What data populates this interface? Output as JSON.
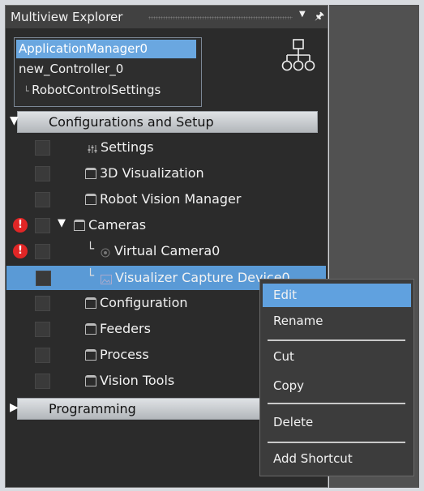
{
  "panel": {
    "title": "Multiview Explorer"
  },
  "controllers": [
    "ApplicationManager0",
    "new_Controller_0",
    "RobotControlSettings"
  ],
  "sections": {
    "config": "Configurations and Setup",
    "programming": "Programming"
  },
  "tree": {
    "settings": "Settings",
    "visualization": "3D Visualization",
    "robot_vision": "Robot Vision Manager",
    "cameras": "Cameras",
    "virtual_camera": "Virtual Camera0",
    "visualizer": "Visualizer Capture Device0",
    "configuration": "Configuration",
    "feeders": "Feeders",
    "process": "Process",
    "vision_tools": "Vision Tools"
  },
  "error_badge": "!",
  "context_menu": {
    "edit": "Edit",
    "rename": "Rename",
    "cut": "Cut",
    "copy": "Copy",
    "delete": "Delete",
    "add_shortcut": "Add Shortcut"
  },
  "colors": {
    "selection": "#5a9ad6",
    "error": "#e12626",
    "menu_highlight": "#60a1df"
  }
}
